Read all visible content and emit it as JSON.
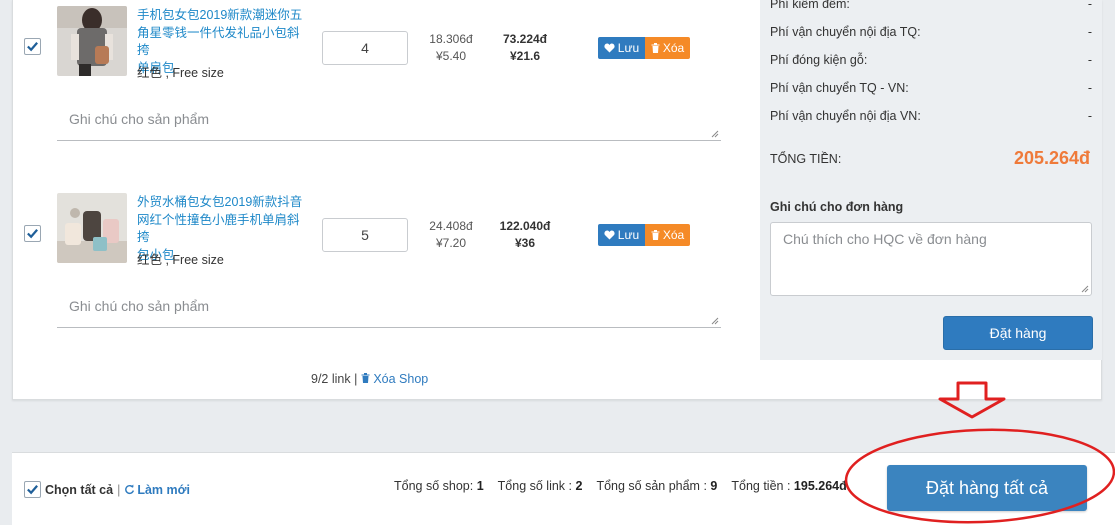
{
  "items": [
    {
      "name": "手机包女包2019新款潮迷你五角星零钱一件代发礼品小包斜挎单肩包",
      "name_lines": [
        "手机包女包2019新款潮迷你五",
        "角星零钱一件代发礼品小包斜挎",
        "单肩包"
      ],
      "variant": "红色 , Free size",
      "quantity": "4",
      "unit_price_vnd": "18.306đ",
      "unit_price_cny": "¥5.40",
      "total_vnd": "73.224đ",
      "total_cny": "¥21.6",
      "save_label": "Lưu",
      "delete_label": "Xóa",
      "note_placeholder": "Ghi chú cho sản phẩm",
      "checked": true
    },
    {
      "name": "外贸水桶包女包2019新款抖音网红个性撞色小鹿手机单肩斜挎包小包",
      "name_lines": [
        "外贸水桶包女包2019新款抖音",
        "网红个性撞色小鹿手机单肩斜挎",
        "包小包"
      ],
      "variant": "红色 , Free size",
      "quantity": "5",
      "unit_price_vnd": "24.408đ",
      "unit_price_cny": "¥7.20",
      "total_vnd": "122.040đ",
      "total_cny": "¥36",
      "save_label": "Lưu",
      "delete_label": "Xóa",
      "note_placeholder": "Ghi chú cho sản phẩm",
      "checked": true
    }
  ],
  "shop_footer": {
    "link_count": "9/2 link",
    "separator": "|",
    "delete_shop": "Xóa Shop"
  },
  "summary": {
    "fees": [
      {
        "label": "Phí kiểm đếm:",
        "value": "-"
      },
      {
        "label": "Phí vận chuyển nội địa TQ:",
        "value": "-"
      },
      {
        "label": "Phí đóng kiện gỗ:",
        "value": "-"
      },
      {
        "label": "Phí vận chuyển TQ - VN:",
        "value": "-"
      },
      {
        "label": "Phí vận chuyển nội địa VN:",
        "value": "-"
      }
    ],
    "total_label": "TỔNG TIỀN:",
    "total_value": "205.264đ",
    "order_note_label": "Ghi chú cho đơn hàng",
    "order_note_placeholder": "Chú thích cho HQC về đơn hàng",
    "order_button": "Đặt hàng"
  },
  "bottom_bar": {
    "select_all": "Chọn tất cả",
    "refresh": "Làm mới",
    "stats": [
      {
        "label": "Tổng số shop:",
        "value": "1"
      },
      {
        "label": "Tổng số link :",
        "value": "2"
      },
      {
        "label": "Tổng số sản phẩm :",
        "value": "9"
      },
      {
        "label": "Tổng tiền :",
        "value": "195.264đ"
      }
    ],
    "order_all_button": "Đặt hàng tất cả"
  },
  "colors": {
    "primary": "#2f7bbf",
    "danger": "#f58a27",
    "total_accent": "#ef7a3a",
    "annotation_red": "#e02020"
  }
}
